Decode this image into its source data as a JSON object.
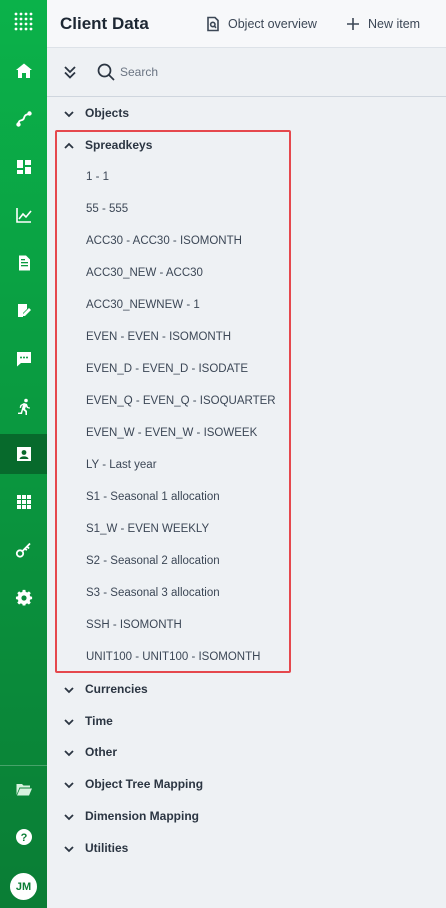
{
  "header": {
    "title": "Client Data",
    "object_overview_label": "Object overview",
    "new_item_label": "New item"
  },
  "toolbar": {
    "search_placeholder": "Search"
  },
  "sidebar": {
    "user_initials": "JM",
    "active_item": "client-data"
  },
  "tree": {
    "sections": [
      {
        "label": "Objects",
        "expanded": false
      },
      {
        "label": "Spreadkeys",
        "expanded": true
      },
      {
        "label": "Currencies",
        "expanded": false
      },
      {
        "label": "Time",
        "expanded": false
      },
      {
        "label": "Other",
        "expanded": false
      },
      {
        "label": "Object Tree Mapping",
        "expanded": false
      },
      {
        "label": "Dimension Mapping",
        "expanded": false
      },
      {
        "label": "Utilities",
        "expanded": false
      }
    ],
    "spreadkeys": [
      "1 - 1",
      "55 - 555",
      "ACC30 - ACC30 - ISOMONTH",
      "ACC30_NEW - ACC30",
      "ACC30_NEWNEW - 1",
      "EVEN - EVEN - ISOMONTH",
      "EVEN_D - EVEN_D - ISODATE",
      "EVEN_Q - EVEN_Q - ISOQUARTER",
      "EVEN_W - EVEN_W - ISOWEEK",
      "LY - Last year",
      "S1 - Seasonal 1 allocation",
      "S1_W - EVEN WEEKLY",
      "S2 - Seasonal 2 allocation",
      "S3 - Seasonal 3 allocation",
      "SSH - ISOMONTH",
      "UNIT100 - UNIT100 - ISOMONTH"
    ]
  },
  "colors": {
    "sidebar_green": "#0bb24a",
    "sidebar_active": "#076a2c",
    "highlight_red": "#e5484d"
  }
}
